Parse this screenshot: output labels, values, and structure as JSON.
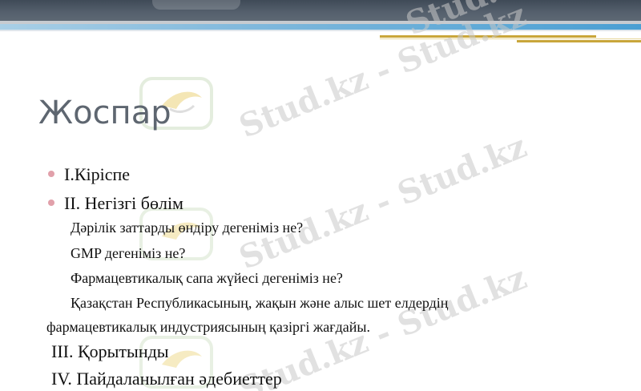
{
  "slide": {
    "title": "Жоспар",
    "bullets": [
      "I.Кіріспе",
      "II. Негізгі бөлім"
    ],
    "sub_items": [
      "Дәрілік заттарды өндіру дегеніміз не?",
      "GMP дегеніміз не?",
      "Фармацевтикалық сапа жүйесі дегеніміз не?",
      "Қазақстан Республикасының, жақын және алыс шет елдердің",
      "фармацевтикалық индустриясының қазіргі жағдайы."
    ],
    "sections": [
      "III. Қорытынды",
      "IV. Пайдаланылған әдебиеттер"
    ]
  },
  "watermark": {
    "text": "Stud.kz - Stud.kz"
  },
  "colors": {
    "title": "#5e6670",
    "bullet": "#e1a0aa",
    "header_dark": "#4a5562",
    "header_blue": "#4a9fd3",
    "accent_gold": "#c9a63a"
  }
}
